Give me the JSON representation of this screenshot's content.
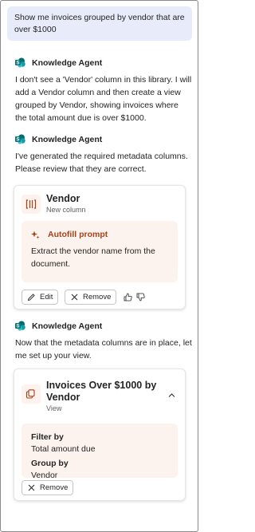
{
  "user_prompt": "Show me invoices grouped by vendor that are over $1000",
  "agent_name": "Knowledge Agent",
  "messages": [
    "I don't see a 'Vendor' column in this library. I will add a Vendor column and then create a view grouped by Vendor, showing invoices where the total amount due is over $1000.",
    "I've generated the required metadata columns. Please review that they are correct.",
    "Now that the metadata columns are in place, let me set up your view."
  ],
  "column_card": {
    "title": "Vendor",
    "subtitle": "New column",
    "autofill_title": "Autofill prompt",
    "autofill_text": "Extract the vendor name from the document.",
    "edit_label": "Edit",
    "remove_label": "Remove",
    "icon": "column-icon"
  },
  "view_card": {
    "title": "Invoices Over $1000 by Vendor",
    "subtitle": "View",
    "filter_label": "Filter by",
    "filter_value": "Total amount due",
    "group_label": "Group by",
    "group_value": "Vendor",
    "remove_label": "Remove",
    "icon": "view-icon"
  },
  "colors": {
    "user_bubble": "#e8ebfa",
    "accent_orange": "#a4421a",
    "tile_bg": "#fdf2ee",
    "sharepoint_teal": "#038387"
  }
}
